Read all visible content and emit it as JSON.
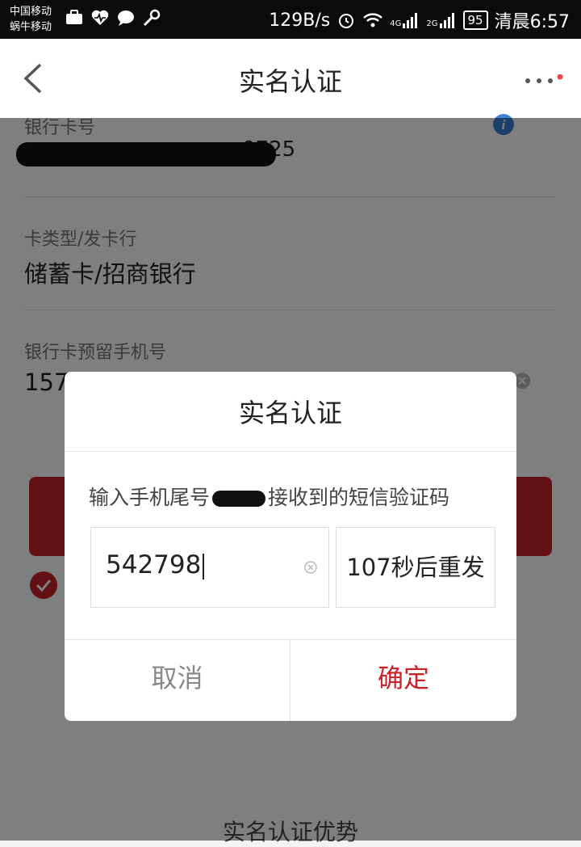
{
  "status_bar": {
    "carrier1": "中国移动",
    "carrier2": "蜗牛移动",
    "net_speed": "129B/s",
    "signal1": "4G",
    "signal2": "2G",
    "battery": "95",
    "time": "清晨6:57",
    "icons": [
      "briefcase-icon",
      "heart-rate-icon",
      "chat-icon",
      "key-icon",
      "alarm-icon",
      "wifi-icon",
      "signal-icon"
    ]
  },
  "nav": {
    "title": "实名认证",
    "back_icon": "chevron-left-icon",
    "more_icon": "more-dots-icon",
    "accent_color": "#e8474c"
  },
  "form": {
    "card_number_label": "银行卡号",
    "card_number_value_partial": "0725",
    "card_type_label": "卡类型/发卡行",
    "card_type_value": "储蓄卡/招商银行",
    "phone_label": "银行卡预留手机号",
    "phone_value_partial": "157"
  },
  "page": {
    "advantage_title": "实名认证优势",
    "primary_color": "#c9232a"
  },
  "dialog": {
    "title": "实名认证",
    "message_prefix": "输入手机尾号",
    "message_suffix": "接收到的短信验证码",
    "code_value": "542798",
    "resend_text": "107秒后重发",
    "cancel_label": "取消",
    "confirm_label": "确定"
  }
}
